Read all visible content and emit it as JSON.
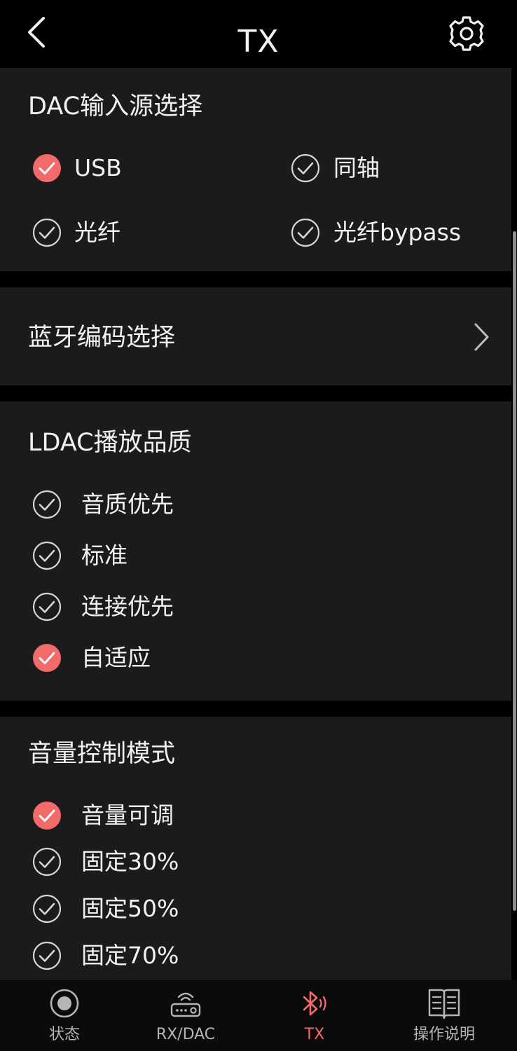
{
  "header": {
    "title": "TX",
    "back_icon": "chevron-left-icon",
    "settings_icon": "gear-icon"
  },
  "colors": {
    "accent": "#f26a6a",
    "panel": "#1b1b1c",
    "background": "#000000",
    "text": "#f2f2f2",
    "muted": "#b5b5b5"
  },
  "dac_input": {
    "title": "DAC输入源选择",
    "options": [
      {
        "label": "USB",
        "checked": true
      },
      {
        "label": "同轴",
        "checked": false
      },
      {
        "label": "光纤",
        "checked": false
      },
      {
        "label": "光纤bypass",
        "checked": false
      }
    ]
  },
  "bt_codec": {
    "title": "蓝牙编码选择",
    "icon": "chevron-right-icon"
  },
  "ldac_quality": {
    "title": "LDAC播放品质",
    "options": [
      {
        "label": "音质优先",
        "checked": false
      },
      {
        "label": "标准",
        "checked": false
      },
      {
        "label": "连接优先",
        "checked": false
      },
      {
        "label": "自适应",
        "checked": true
      }
    ]
  },
  "volume_mode": {
    "title": "音量控制模式",
    "options": [
      {
        "label": "音量可调",
        "checked": true
      },
      {
        "label": "固定30%",
        "checked": false
      },
      {
        "label": "固定50%",
        "checked": false
      },
      {
        "label": "固定70%",
        "checked": false
      }
    ]
  },
  "tabs": [
    {
      "label": "状态",
      "icon": "record-icon",
      "active": false
    },
    {
      "label": "RX/DAC",
      "icon": "router-icon",
      "active": false
    },
    {
      "label": "TX",
      "icon": "bluetooth-icon",
      "active": true
    },
    {
      "label": "操作说明",
      "icon": "manual-book-icon",
      "active": false
    }
  ]
}
